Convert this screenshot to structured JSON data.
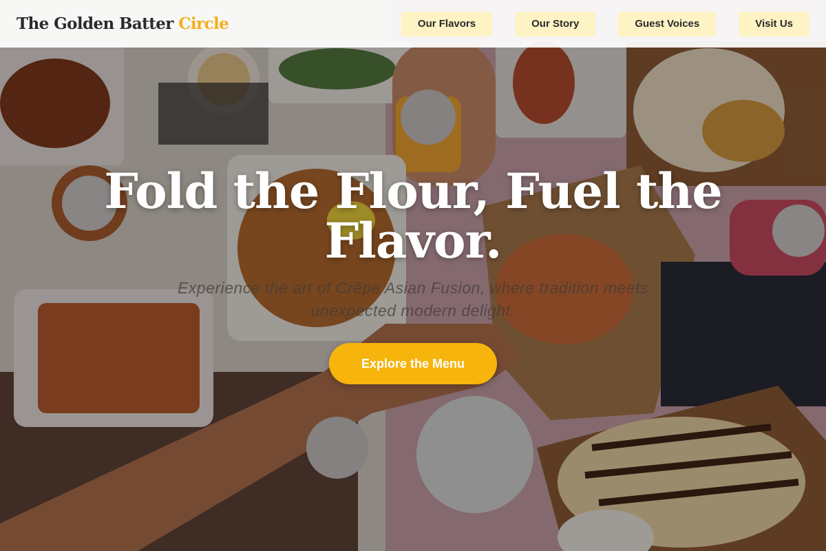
{
  "brand": {
    "name_main": "The Golden Batter",
    "name_accent": "Circle",
    "accent_color": "#f2b01e"
  },
  "nav": {
    "items": [
      {
        "label": "Our Flavors"
      },
      {
        "label": "Our Story"
      },
      {
        "label": "Guest Voices"
      },
      {
        "label": "Visit Us"
      }
    ]
  },
  "hero": {
    "title": "Fold the Flour, Fuel the Flavor.",
    "subtitle": "Experience the art of Crêpe Asian Fusion, where tradition meets unexpected modern delight.",
    "cta_label": "Explore the Menu",
    "cta_color": "#f6b40c",
    "background": "overhead photo of a table with Asian fusion dishes, crêpes with chocolate drizzle, cans of drinks and hands reaching"
  }
}
